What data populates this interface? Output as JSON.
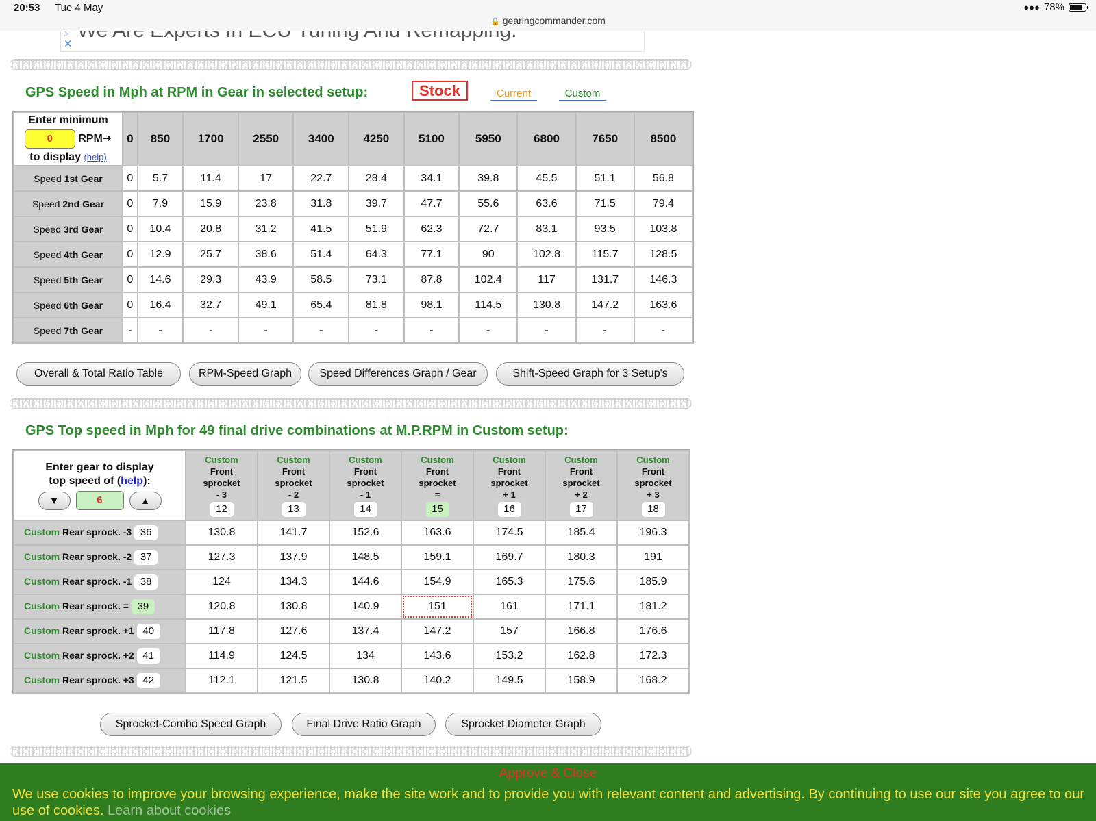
{
  "status_bar": {
    "time": "20:53",
    "date": "Tue 4 May",
    "url": "gearingcommander.com",
    "battery": "78%"
  },
  "ad": {
    "text": "We Are Experts In ECU Tuning And Remapping."
  },
  "section1": {
    "heading": "GPS Speed in Mph at RPM in Gear in selected setup:",
    "tabs": {
      "stock": "Stock",
      "current": "Current",
      "custom": "Custom"
    },
    "corner": {
      "line1": "Enter minimum",
      "rpm_value": "0",
      "rpm_label": "RPM",
      "line3": "to display",
      "help": "(help)"
    },
    "rpm_headers": [
      "0",
      "850",
      "1700",
      "2550",
      "3400",
      "4250",
      "5100",
      "5950",
      "6800",
      "7650",
      "8500"
    ],
    "rows": [
      {
        "prefix": "Speed",
        "gear": "1st Gear",
        "values": [
          "0",
          "5.7",
          "11.4",
          "17",
          "22.7",
          "28.4",
          "34.1",
          "39.8",
          "45.5",
          "51.1",
          "56.8"
        ]
      },
      {
        "prefix": "Speed",
        "gear": "2nd Gear",
        "values": [
          "0",
          "7.9",
          "15.9",
          "23.8",
          "31.8",
          "39.7",
          "47.7",
          "55.6",
          "63.6",
          "71.5",
          "79.4"
        ]
      },
      {
        "prefix": "Speed",
        "gear": "3rd Gear",
        "values": [
          "0",
          "10.4",
          "20.8",
          "31.2",
          "41.5",
          "51.9",
          "62.3",
          "72.7",
          "83.1",
          "93.5",
          "103.8"
        ]
      },
      {
        "prefix": "Speed",
        "gear": "4th Gear",
        "values": [
          "0",
          "12.9",
          "25.7",
          "38.6",
          "51.4",
          "64.3",
          "77.1",
          "90",
          "102.8",
          "115.7",
          "128.5"
        ]
      },
      {
        "prefix": "Speed",
        "gear": "5th Gear",
        "values": [
          "0",
          "14.6",
          "29.3",
          "43.9",
          "58.5",
          "73.1",
          "87.8",
          "102.4",
          "117",
          "131.7",
          "146.3"
        ]
      },
      {
        "prefix": "Speed",
        "gear": "6th Gear",
        "values": [
          "0",
          "16.4",
          "32.7",
          "49.1",
          "65.4",
          "81.8",
          "98.1",
          "114.5",
          "130.8",
          "147.2",
          "163.6"
        ]
      },
      {
        "prefix": "Speed",
        "gear": "7th Gear",
        "values": [
          "-",
          "-",
          "-",
          "-",
          "-",
          "-",
          "-",
          "-",
          "-",
          "-",
          "-"
        ]
      }
    ],
    "buttons": [
      "Overall & Total Ratio Table",
      "RPM-Speed Graph",
      "Speed Differences Graph / Gear",
      "Shift-Speed Graph for 3 Setup's"
    ]
  },
  "section2": {
    "heading": "GPS Top speed in Mph for 49 final drive combinations at M.P.RPM in Custom setup:",
    "corner": {
      "line1": "Enter gear to display",
      "line2": "top speed of (",
      "help": "help",
      "line2_end": "):",
      "gear_value": "6",
      "down": "▼",
      "up": "▲"
    },
    "columns": [
      {
        "custom": "Custom",
        "front": "Front",
        "sprocket": "sprocket",
        "delta": "- 3",
        "teeth": "12"
      },
      {
        "custom": "Custom",
        "front": "Front",
        "sprocket": "sprocket",
        "delta": "- 2",
        "teeth": "13"
      },
      {
        "custom": "Custom",
        "front": "Front",
        "sprocket": "sprocket",
        "delta": "- 1",
        "teeth": "14"
      },
      {
        "custom": "Custom",
        "front": "Front",
        "sprocket": "sprocket",
        "delta": "=",
        "teeth": "15"
      },
      {
        "custom": "Custom",
        "front": "Front",
        "sprocket": "sprocket",
        "delta": "+ 1",
        "teeth": "16"
      },
      {
        "custom": "Custom",
        "front": "Front",
        "sprocket": "sprocket",
        "delta": "+ 2",
        "teeth": "17"
      },
      {
        "custom": "Custom",
        "front": "Front",
        "sprocket": "sprocket",
        "delta": "+ 3",
        "teeth": "18"
      }
    ],
    "rows": [
      {
        "custom": "Custom",
        "label": "Rear sprock.",
        "delta": "-3",
        "teeth": "36",
        "values": [
          "130.8",
          "141.7",
          "152.6",
          "163.6",
          "174.5",
          "185.4",
          "196.3"
        ]
      },
      {
        "custom": "Custom",
        "label": "Rear sprock.",
        "delta": "-2",
        "teeth": "37",
        "values": [
          "127.3",
          "137.9",
          "148.5",
          "159.1",
          "169.7",
          "180.3",
          "191"
        ]
      },
      {
        "custom": "Custom",
        "label": "Rear sprock.",
        "delta": "-1",
        "teeth": "38",
        "values": [
          "124",
          "134.3",
          "144.6",
          "154.9",
          "165.3",
          "175.6",
          "185.9"
        ]
      },
      {
        "custom": "Custom",
        "label": "Rear sprock.",
        "delta": "=",
        "teeth": "39",
        "values": [
          "120.8",
          "130.8",
          "140.9",
          "151",
          "161",
          "171.1",
          "181.2"
        ]
      },
      {
        "custom": "Custom",
        "label": "Rear sprock.",
        "delta": "+1",
        "teeth": "40",
        "values": [
          "117.8",
          "127.6",
          "137.4",
          "147.2",
          "157",
          "166.8",
          "176.6"
        ]
      },
      {
        "custom": "Custom",
        "label": "Rear sprock.",
        "delta": "+2",
        "teeth": "41",
        "values": [
          "114.9",
          "124.5",
          "134",
          "143.6",
          "153.2",
          "162.8",
          "172.3"
        ]
      },
      {
        "custom": "Custom",
        "label": "Rear sprock.",
        "delta": "+3",
        "teeth": "42",
        "values": [
          "112.1",
          "121.5",
          "130.8",
          "140.2",
          "149.5",
          "158.9",
          "168.2"
        ]
      }
    ],
    "buttons": [
      "Sprocket-Combo Speed Graph",
      "Final Drive Ratio Graph",
      "Sprocket Diameter Graph"
    ]
  },
  "cookie": {
    "approve": "Approve & Close",
    "text": "We use cookies to improve your browsing experience, make the site work and to provide you with relevant content and advertising. By continuing to use our site you agree to our use of cookies.",
    "learn": "Learn about cookies"
  }
}
